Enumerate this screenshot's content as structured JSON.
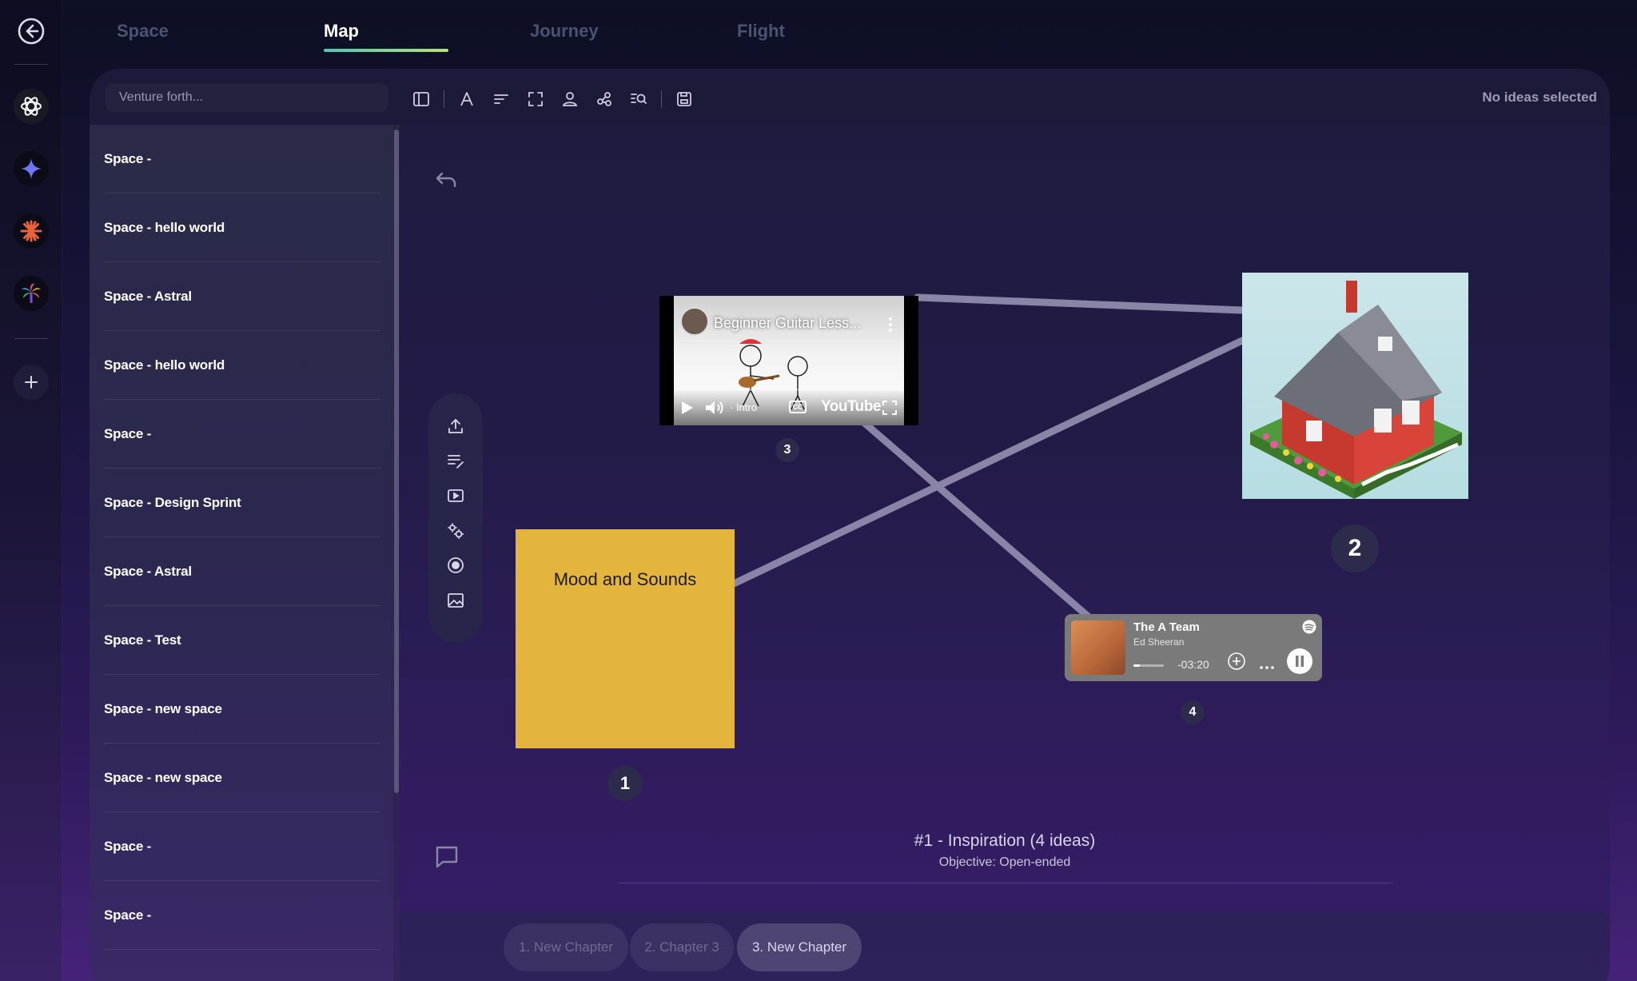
{
  "rail": {
    "items": [
      {
        "name": "back",
        "icon": "back-arrow-icon"
      },
      {
        "name": "openai",
        "icon": "openai-logo-icon"
      },
      {
        "name": "gemini",
        "icon": "sparkle-logo-icon"
      },
      {
        "name": "claude",
        "icon": "starburst-logo-icon"
      },
      {
        "name": "palm",
        "icon": "palm-logo-icon"
      },
      {
        "name": "add",
        "icon": "plus-icon"
      }
    ]
  },
  "tabs": [
    {
      "label": "Space"
    },
    {
      "label": "Map",
      "active": true
    },
    {
      "label": "Journey"
    },
    {
      "label": "Flight"
    }
  ],
  "search": {
    "placeholder": "Venture forth..."
  },
  "toolbar": {
    "icons": [
      "sidebar-toggle-icon",
      "text-icon",
      "align-icon",
      "fullscreen-icon",
      "person-icon",
      "share-nodes-icon",
      "search-list-icon",
      "save-icon"
    ],
    "selection_status": "No ideas selected"
  },
  "sidebar": {
    "items": [
      {
        "label": "Space -"
      },
      {
        "label": "Space - hello world"
      },
      {
        "label": "Space - Astral"
      },
      {
        "label": "Space - hello world"
      },
      {
        "label": "Space -"
      },
      {
        "label": "Space - Design Sprint"
      },
      {
        "label": "Space - Astral"
      },
      {
        "label": "Space - Test"
      },
      {
        "label": "Space - new space"
      },
      {
        "label": "Space - new space"
      },
      {
        "label": "Space -"
      },
      {
        "label": "Space -"
      }
    ]
  },
  "canvas": {
    "tools": [
      "upload-icon",
      "edit-text-icon",
      "video-icon",
      "settings-icon",
      "target-icon",
      "image-icon"
    ],
    "ideas": {
      "note": {
        "text": "Mood and Sounds",
        "number": "1"
      },
      "image": {
        "number": "2"
      },
      "video": {
        "title": "Beginner Guitar Less...",
        "chapter": "· Intro",
        "brand": "YouTube",
        "number": "3"
      },
      "music": {
        "title": "The A Team",
        "artist": "Ed Sheeran",
        "time": "-03:20",
        "number": "4"
      }
    },
    "chapter": {
      "title": "#1 - Inspiration (4 ideas)",
      "objective": "Objective: Open-ended"
    }
  },
  "chapters": [
    {
      "label": "1. New Chapter"
    },
    {
      "label": "2. Chapter 3"
    },
    {
      "label": "3. New Chapter",
      "active": true
    }
  ],
  "colors": {
    "note": "#e3b53c",
    "tab_underline_start": "#4fc7b4",
    "tab_underline_end": "#b9e07a",
    "connector": "#9c98b8"
  }
}
